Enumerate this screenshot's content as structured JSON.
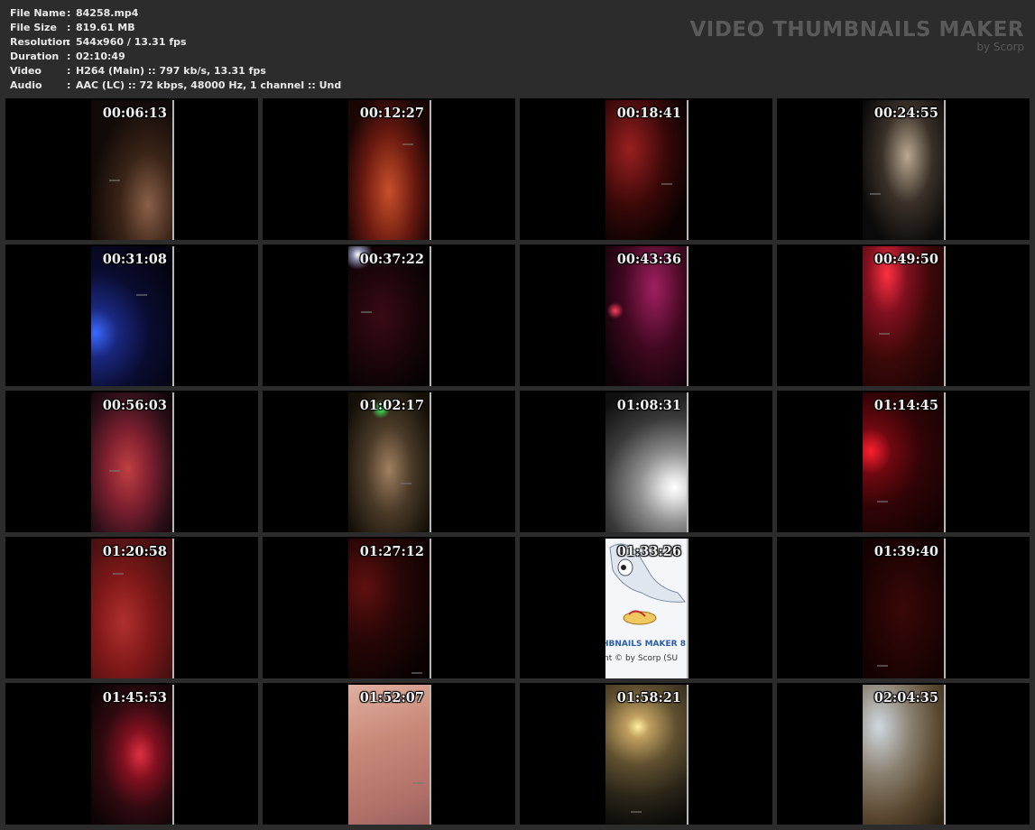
{
  "info": {
    "rows": [
      {
        "key": "File Name",
        "sep": ":",
        "value": "84258.mp4"
      },
      {
        "key": "File Size",
        "sep": ":",
        "value": "819.61 MB"
      },
      {
        "key": "Resolution",
        "sep": ":",
        "value": "544x960 / 13.31 fps"
      },
      {
        "key": "Duration",
        "sep": ":",
        "value": "02:10:49"
      },
      {
        "key": "Video",
        "sep": ":",
        "value": "H264 (Main) :: 797 kb/s, 13.31 fps"
      },
      {
        "key": "Audio",
        "sep": ":",
        "value": "AAC (LC) :: 72 kbps, 48000 Hz, 1 channel :: Und"
      }
    ]
  },
  "brand": {
    "title": "VIDEO THUMBNAILS MAKER",
    "subtitle": "by Scorp"
  },
  "thumbnails": [
    {
      "time": "00:06:13"
    },
    {
      "time": "00:12:27"
    },
    {
      "time": "00:18:41"
    },
    {
      "time": "00:24:55"
    },
    {
      "time": "00:31:08"
    },
    {
      "time": "00:37:22"
    },
    {
      "time": "00:43:36"
    },
    {
      "time": "00:49:50"
    },
    {
      "time": "00:56:03"
    },
    {
      "time": "01:02:17"
    },
    {
      "time": "01:08:31"
    },
    {
      "time": "01:14:45"
    },
    {
      "time": "01:20:58"
    },
    {
      "time": "01:27:12"
    },
    {
      "time": "01:33:26",
      "logo_line1": "HBNAILS MAKER 8",
      "logo_line2": "nt © by Scorp (SU"
    },
    {
      "time": "01:39:40"
    },
    {
      "time": "01:45:53"
    },
    {
      "time": "01:52:07"
    },
    {
      "time": "01:58:21"
    },
    {
      "time": "02:04:35"
    }
  ]
}
